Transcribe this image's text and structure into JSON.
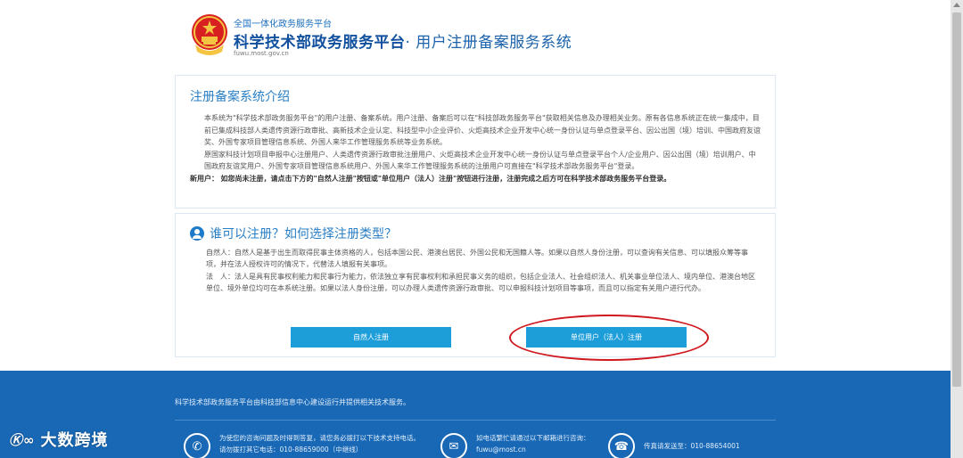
{
  "header": {
    "small_title": "全国一体化政务服务平台",
    "main_title": "科学技术部政务服务平台",
    "sub_title": "· 用户注册备案服务系统",
    "url": "fuwu.most.gov.cn"
  },
  "intro": {
    "title": "注册备案系统介绍",
    "para1": "本系统为\"科学技术部政务服务平台\"的用户注册、备案系统。用户注册、备案后可以在\"科技部政务服务平台\"获取相关信息及办理相关业务。原有各信息系统正在统一集成中，目前已集成科技部人类遗传资源行政审批、高新技术企业认定、科技型中小企业评价、火炬高技术企业开发中心统一身份认证与单点登录平台、因公出国（境）培训、中国政府友谊奖、外国专家项目管理信息系统、外国人来华工作管理服务系统等业务系统。",
    "para2": "原国家科技计划项目申报中心注册用户、人类遗传资源行政审批注册用户、火炬高技术企业开发中心统一身份认证与单点登录平台个人/企业用户、因公出国（境）培训用户、中国政府友谊奖用户、外国专家项目管理信息系统用户、外国人来华工作管理服务系统的注册用户可直接在\"科学技术部政务服务平台\"登录。",
    "new_user_label": "新用户：",
    "new_user_text": "如您尚未注册，请点击下方的\"自然人注册\"按钮或\"单位用户（法人）注册\"按钮进行注册，注册完成之后方可在科学技术部政务服务平台登录。"
  },
  "who": {
    "title": "谁可以注册？如何选择注册类型？",
    "natural": "自然人：自然人是基于出生而取得民事主体资格的人，包括本国公民、港澳台居民、外国公民和无国籍人等。如果以自然人身份注册，可以查询有关信息、可以填报众筹等事项，并在法人授权许可的情况下，代替法人填报有关事项。",
    "legal": "法　人：法人是具有民事权利能力和民事行为能力，依法独立享有民事权利和承担民事义务的组织，包括企业法人、社会组织法人、机关事业单位法人、境内单位、港澳台地区单位、境外单位均可在本系统注册。如果以法人身份注册，可以办理人类遗传资源行政审批、可以申报科技计划项目等事项，而且可以指定有关用户进行代办。",
    "btn_natural": "自然人注册",
    "btn_legal": "单位用户（法人）注册"
  },
  "footer": {
    "line": "科学技术部政务服务平台由科技部信息中心建设运行并提供相关技术服务。",
    "phone_text1": "为使您的咨询问题及时得到答复，请您务必拨打以下技术支持电话。",
    "phone_text2": "请勿拨打其它电话：010-88659000（中继线）",
    "email_text1": "如电话繁忙请通过以下邮箱进行咨询：",
    "email_text2": "fuwu@most.cn",
    "fax_text": "传真请发送至：010-88654001"
  },
  "watermark": {
    "logo": "Ⓚ∞",
    "text": "大数跨境"
  },
  "colors": {
    "primary": "#1868b5",
    "button": "#1d9ed9",
    "highlight": "#d0181f"
  }
}
